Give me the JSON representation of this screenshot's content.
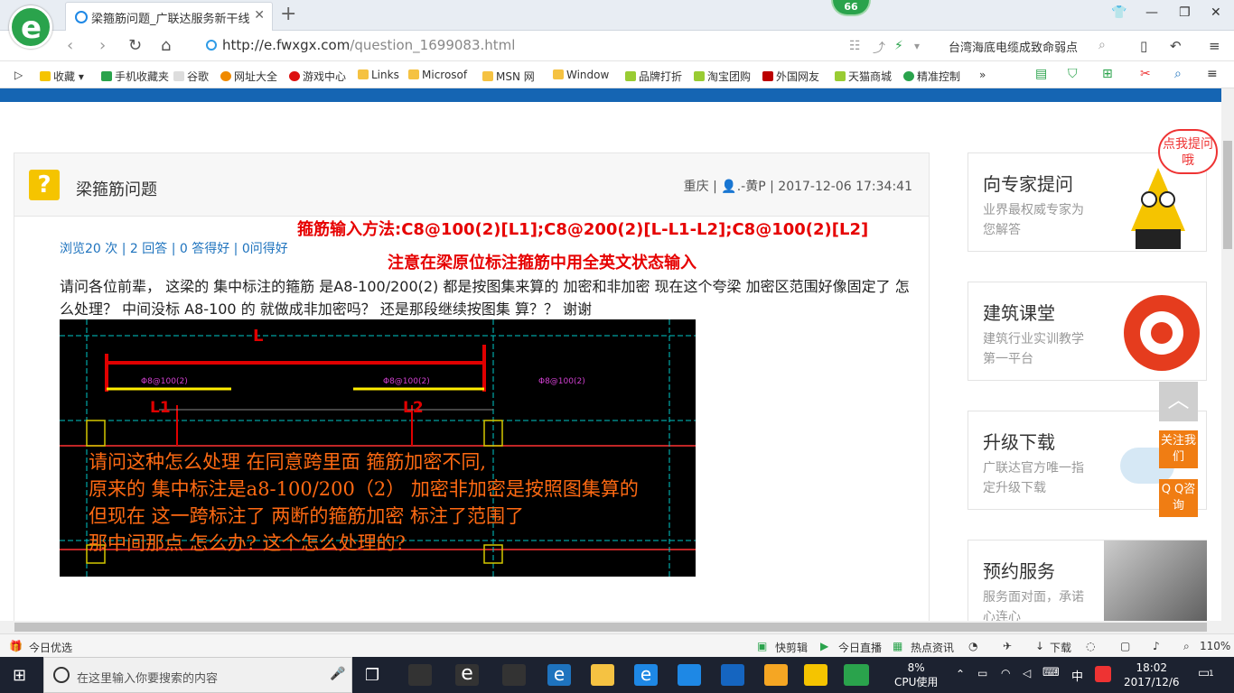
{
  "browser": {
    "tab_title": "梁箍筋问题_广联达服务新干线",
    "badge_count": "66",
    "url_host": "http://e.fwxgx.com",
    "url_path": "/question_1699083.html",
    "search_text": "台湾海底电缆成致命弱点"
  },
  "bookmarks": [
    "收藏",
    "手机收藏夹",
    "谷歌",
    "网址大全",
    "游戏中心",
    "Links",
    "Microsof",
    "MSN 网",
    "Window",
    "品牌打折",
    "淘宝团购",
    "外国网友",
    "天猫商城",
    "精准控制"
  ],
  "question": {
    "title": "梁箍筋问题",
    "location": "重庆",
    "user": ".-黄P",
    "datetime": "2017-12-06 17:34:41",
    "stats": "浏览20 次 | 2 回答 | 0 答得好 | 0问得好",
    "red_note_1": "箍筋输入方法:C8@100(2)[L1];C8@200(2)[L-L1-L2];C8@100(2)[L2]",
    "red_note_2": "注意在梁原位标注箍筋中用全英文状态输入",
    "body": "请问各位前辈， 这梁的 集中标注的箍筋 是A8-100/200(2)   都是按图集来算的 加密和非加密  现在这个夸梁 加密区范围好像固定了  怎么处理？  中间没标 A8-100 的  就做成非加密吗？ 还是那段继续按图集 算？？  谢谢"
  },
  "cad": {
    "label_L": "L",
    "label_L1": "L1",
    "label_L2": "L2",
    "tag1": "Φ8@100(2)",
    "tag2": "Φ8@100(2)",
    "tag3": "Φ8@100(2)",
    "hand1": "请问这种怎么处理   在同意跨里面  箍筋加密不同,",
    "hand2": "原来的   集中标注是a8-100/200（2）   加密非加密是按照图集算的",
    "hand3": "但现在 这一跨标注了 两断的箍筋加密  标注了范围了",
    "hand4": "那中间那点   怎么办?    这个怎么处理的?"
  },
  "sidebar": {
    "ask_bubble": "点我提问哦",
    "cards": [
      {
        "title": "向专家提问",
        "sub": "业界最权威专家为您解答"
      },
      {
        "title": "建筑课堂",
        "sub": "建筑行业实训教学第一平台"
      },
      {
        "title": "升级下载",
        "sub": "广联达官方唯一指定升级下载"
      },
      {
        "title": "预约服务",
        "sub": "服务面对面，承诺心连心"
      }
    ],
    "float_follow": "关注我们",
    "float_qq": "Q Q咨询"
  },
  "statusbar": {
    "left": "今日优选",
    "items": [
      "快剪辑",
      "今日直播",
      "热点资讯",
      "下载"
    ],
    "zoom": "110%"
  },
  "taskbar": {
    "search_placeholder": "在这里输入你要搜索的内容",
    "cpu_percent": "8%",
    "cpu_label": "CPU使用",
    "ime": "中",
    "time": "18:02",
    "date": "2017/12/6",
    "notif_count": "1"
  }
}
